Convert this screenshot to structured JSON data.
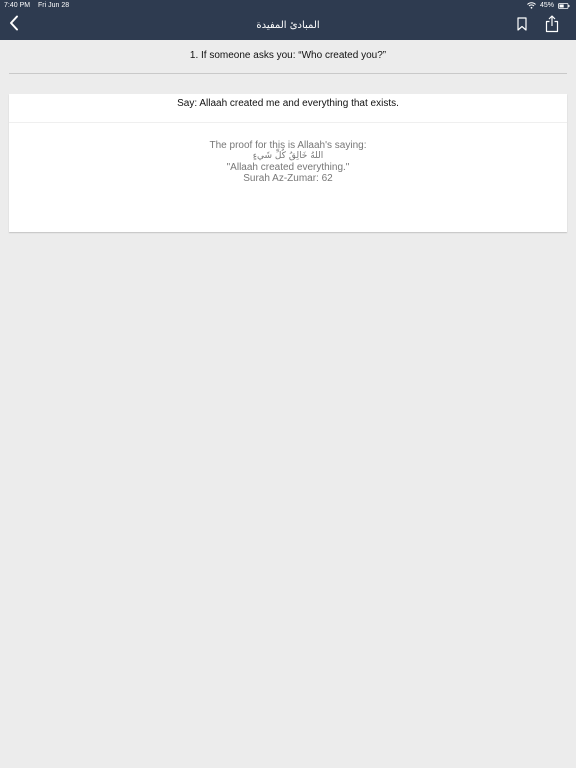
{
  "status_bar": {
    "time": "7:40 PM",
    "date": "Fri Jun 28",
    "battery": "45%"
  },
  "nav": {
    "title": "المبادئ المفيدة",
    "icons": {
      "back": "chevron-left-icon",
      "bookmark": "bookmark-icon",
      "share": "share-icon"
    }
  },
  "colors": {
    "header_bg": "#2e3b50",
    "page_bg": "#ececec",
    "card_bg": "#ffffff",
    "proof_text": "#777777"
  },
  "question": {
    "text": "1. If someone asks you: “Who created you?”"
  },
  "answer": {
    "text": "Say: Allaah created me and everything that exists.",
    "proof": {
      "intro": "The proof for this is Allaah's saying:",
      "arabic": "اللهُ خَالِقُ كُلِّ شَيءٍ",
      "translation": "\"Allaah created everything.\"",
      "reference": "Surah Az-Zumar: 62"
    }
  }
}
